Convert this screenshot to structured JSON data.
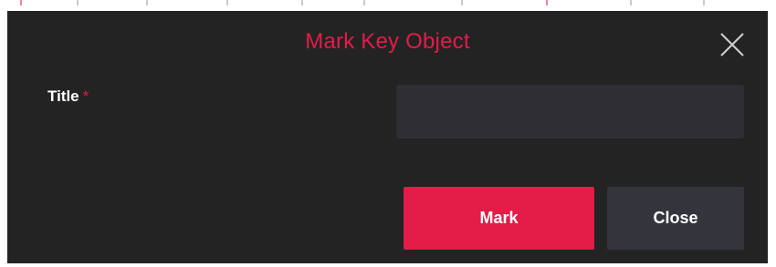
{
  "dialog": {
    "title": "Mark Key Object",
    "close_icon": "close-icon",
    "fields": {
      "title_label": "Title",
      "required_marker": "*",
      "title_value": "",
      "title_placeholder": ""
    },
    "buttons": {
      "mark_label": "Mark",
      "close_label": "Close"
    }
  },
  "colors": {
    "accent": "#e31c48",
    "dialog_bg": "#232323",
    "input_bg": "#2f2f33",
    "secondary_button_bg": "#34343d",
    "text": "#ffffff"
  }
}
